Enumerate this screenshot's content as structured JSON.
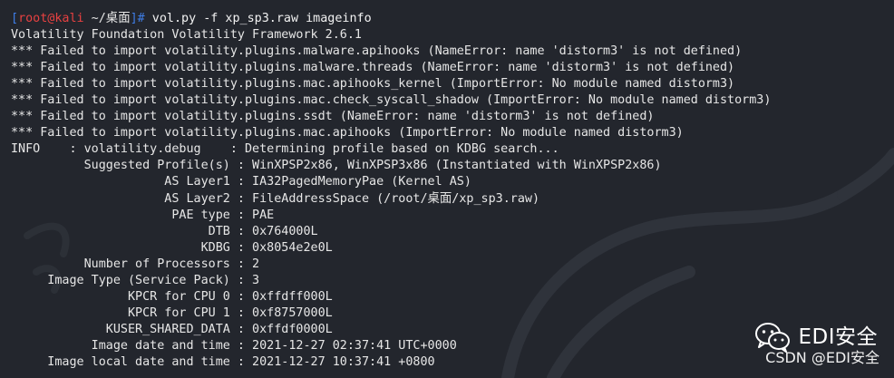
{
  "prompt": {
    "open_bracket": "[",
    "user_host": "root@kali",
    "path": " ~/桌面",
    "close": "]# ",
    "command": "vol.py -f xp_sp3.raw imageinfo"
  },
  "output_lines": [
    "Volatility Foundation Volatility Framework 2.6.1",
    "*** Failed to import volatility.plugins.malware.apihooks (NameError: name 'distorm3' is not defined)",
    "*** Failed to import volatility.plugins.malware.threads (NameError: name 'distorm3' is not defined)",
    "*** Failed to import volatility.plugins.mac.apihooks_kernel (ImportError: No module named distorm3)",
    "*** Failed to import volatility.plugins.mac.check_syscall_shadow (ImportError: No module named distorm3)",
    "*** Failed to import volatility.plugins.ssdt (NameError: name 'distorm3' is not defined)",
    "*** Failed to import volatility.plugins.mac.apihooks (ImportError: No module named distorm3)",
    "INFO    : volatility.debug    : Determining profile based on KDBG search...",
    "          Suggested Profile(s) : WinXPSP2x86, WinXPSP3x86 (Instantiated with WinXPSP2x86)",
    "                     AS Layer1 : IA32PagedMemoryPae (Kernel AS)",
    "                     AS Layer2 : FileAddressSpace (/root/桌面/xp_sp3.raw)",
    "                      PAE type : PAE",
    "                           DTB : 0x764000L",
    "                          KDBG : 0x8054e2e0L",
    "          Number of Processors : 2",
    "     Image Type (Service Pack) : 3",
    "                KPCR for CPU 0 : 0xffdff000L",
    "                KPCR for CPU 1 : 0xf8757000L",
    "             KUSER_SHARED_DATA : 0xffdf0000L",
    "           Image date and time : 2021-12-27 02:37:41 UTC+0000",
    "     Image local date and time : 2021-12-27 10:37:41 +0800"
  ],
  "watermark": {
    "title": "EDI安全",
    "subtitle": "CSDN @EDI安全"
  },
  "colors": {
    "background": "#23262d",
    "prompt_bracket": "#3e7de6",
    "prompt_user": "#e84141",
    "text": "#e6e6e6"
  },
  "icons": {
    "watermark_icon": "wechat-icon",
    "background_art": "kali-dragon-icon"
  }
}
